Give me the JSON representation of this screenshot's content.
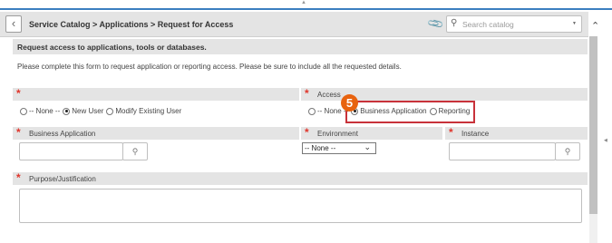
{
  "header": {
    "breadcrumb": "Service Catalog > Applications > Request for Access",
    "search_placeholder": "Search catalog"
  },
  "form": {
    "title": "Request access to applications, tools or databases.",
    "instructions": "Please complete this form to request application or reporting access. Please be sure to include all the requested details.",
    "request_type": {
      "label": "",
      "options": [
        "-- None --",
        "New User",
        "Modify Existing User"
      ],
      "selected": "New User"
    },
    "access": {
      "label": "Access",
      "options": [
        "-- None --",
        "Business Application",
        "Reporting"
      ],
      "selected": "Business Application"
    },
    "business_application": {
      "label": "Business Application",
      "value": ""
    },
    "environment": {
      "label": "Environment",
      "selected": "-- None --"
    },
    "instance": {
      "label": "Instance",
      "value": ""
    },
    "purpose": {
      "label": "Purpose/Justification",
      "value": ""
    }
  },
  "annotation": {
    "step_number": "5"
  },
  "colors": {
    "required": "#e0352b",
    "highlight": "#c8323a",
    "badge": "#e8630f",
    "accent_line": "#3c7fc0"
  },
  "icons": {
    "back": "chevron-left-icon",
    "attachment": "paperclip-icon",
    "search": "search-icon",
    "scroll_up": "chevron-up-icon"
  }
}
